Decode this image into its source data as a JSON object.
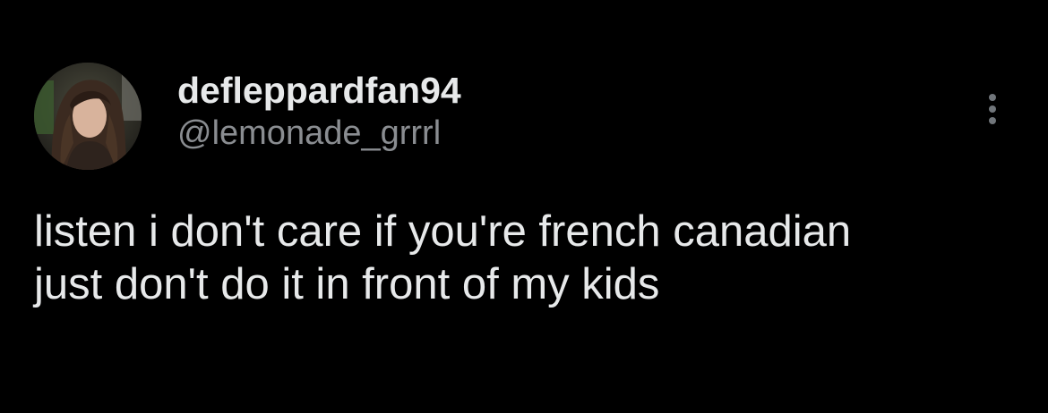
{
  "colors": {
    "background": "#000000",
    "primary_text": "#e7e9ea",
    "secondary_text": "#8a8d91",
    "icon": "#71767b"
  },
  "author": {
    "display_name": "defleppardfan94",
    "handle": "@lemonade_grrrl",
    "avatar_icon": "profile-photo"
  },
  "menu": {
    "icon": "more-options-icon"
  },
  "tweet": {
    "lines": [
      "listen i don't care if you're french canadian",
      "just don't do it in front of my kids"
    ]
  }
}
